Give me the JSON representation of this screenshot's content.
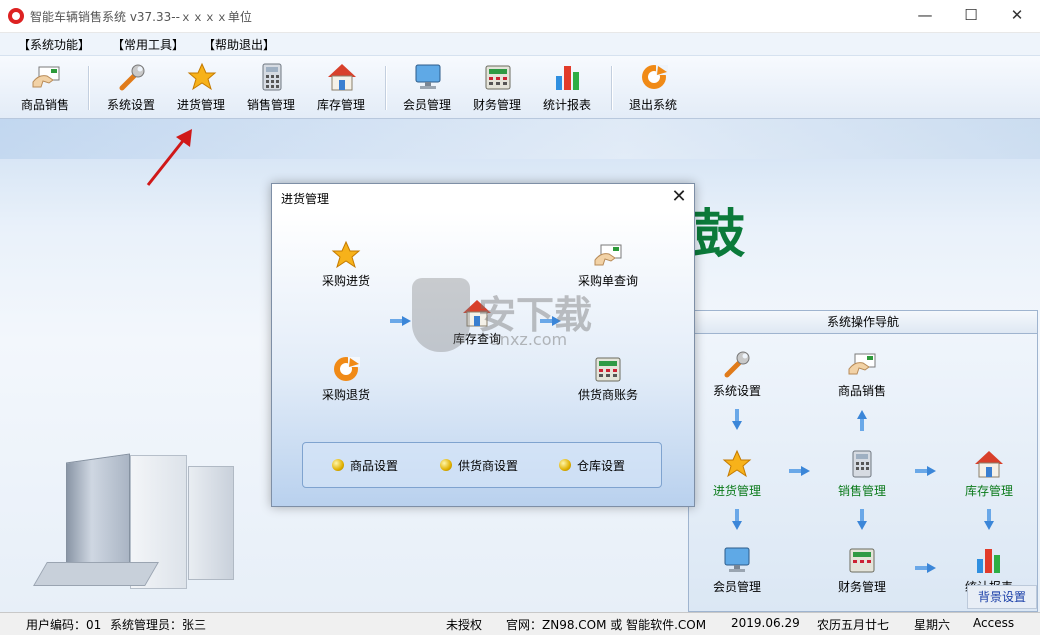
{
  "window": {
    "title": "智能车辆销售系统 v37.33--ｘｘｘｘ单位",
    "minimize_glyph": "—",
    "maximize_glyph": "☐",
    "close_glyph": "✕"
  },
  "menu": [
    {
      "label": "【系统功能】"
    },
    {
      "label": "【常用工具】"
    },
    {
      "label": "【帮助退出】"
    }
  ],
  "toolbar": [
    {
      "label": "商品销售",
      "icon": "hand-card-icon"
    },
    {
      "label": "系统设置",
      "icon": "wrench-icon"
    },
    {
      "label": "进货管理",
      "icon": "star-icon"
    },
    {
      "label": "销售管理",
      "icon": "calculator-icon"
    },
    {
      "label": "库存管理",
      "icon": "house-icon"
    },
    {
      "label": "会员管理",
      "icon": "monitor-icon"
    },
    {
      "label": "财务管理",
      "icon": "cash-register-icon"
    },
    {
      "label": "统计报表",
      "icon": "bar-chart-icon"
    },
    {
      "label": "退出系统",
      "icon": "refresh-icon"
    }
  ],
  "background": {
    "banner_text": "鼓"
  },
  "nav_panel": {
    "title": "系统操作导航",
    "items": [
      {
        "label": "系统设置",
        "icon": "wrench-icon"
      },
      {
        "label": "商品销售",
        "icon": "hand-card-icon"
      },
      {
        "label": "进货管理",
        "icon": "star-icon"
      },
      {
        "label": "销售管理",
        "icon": "calculator-icon"
      },
      {
        "label": "库存管理",
        "icon": "house-icon"
      },
      {
        "label": "会员管理",
        "icon": "monitor-icon"
      },
      {
        "label": "财务管理",
        "icon": "cash-register-icon"
      },
      {
        "label": "统计报表",
        "icon": "bar-chart-icon"
      }
    ],
    "bg_settings_label": "背景设置"
  },
  "dialog": {
    "title": "进货管理",
    "close_glyph": "✕",
    "items": [
      {
        "label": "采购进货",
        "icon": "star-icon"
      },
      {
        "label": "采购单查询",
        "icon": "hand-card-icon"
      },
      {
        "label": "库存查询",
        "icon": "house-icon"
      },
      {
        "label": "采购退货",
        "icon": "refresh-icon"
      },
      {
        "label": "供货商账务",
        "icon": "cash-register-icon"
      }
    ],
    "group_buttons": [
      {
        "label": "商品设置"
      },
      {
        "label": "供货商设置"
      },
      {
        "label": "仓库设置"
      }
    ]
  },
  "watermark": {
    "text": "安下载",
    "url": "anxz.com"
  },
  "status": {
    "user_code": "用户编码：01",
    "admin": "系统管理员：张三",
    "license": "未授权",
    "website": "官网：ZN98.COM 或 智能软件.COM",
    "date": "2019.06.29",
    "lunar": "农历五月廿七",
    "weekday": "星期六",
    "db": "Access"
  }
}
